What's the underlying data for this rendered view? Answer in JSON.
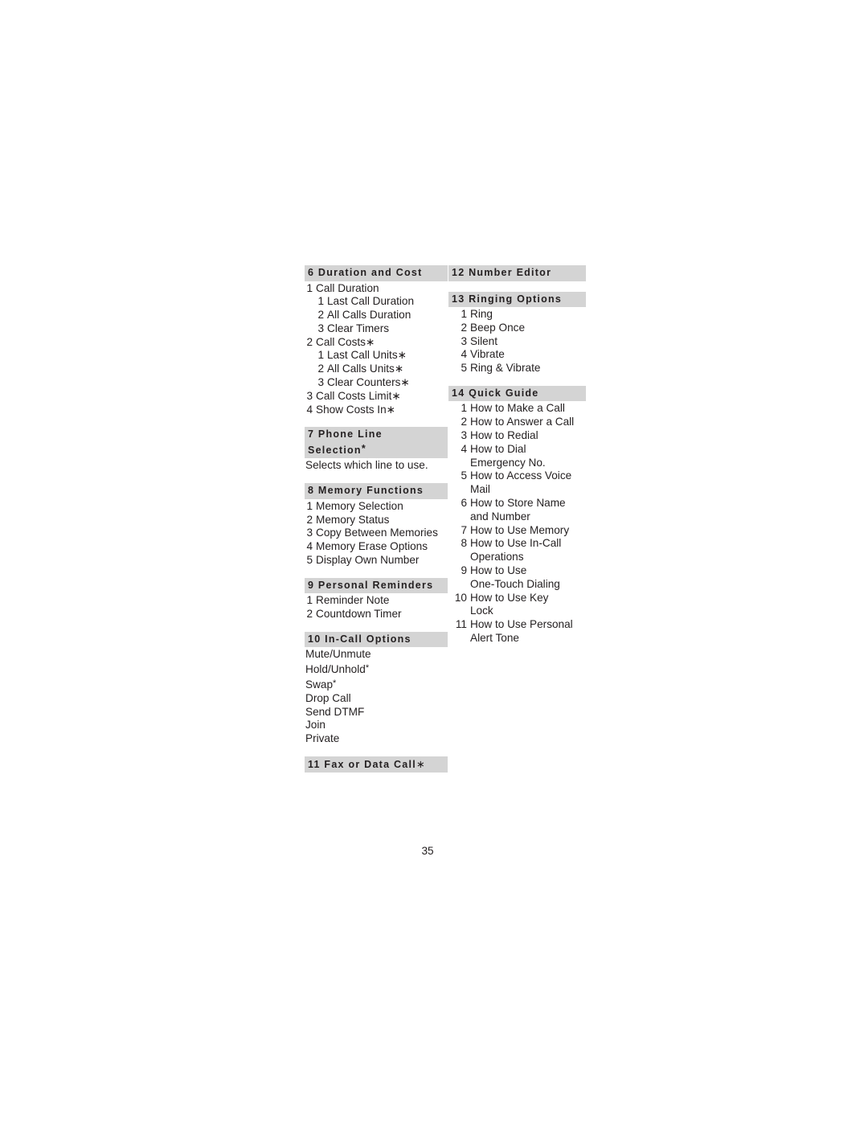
{
  "page": {
    "number": "35"
  },
  "columns": {
    "left": [
      {
        "id": "duration-and-cost",
        "heading": "6 Duration and Cost",
        "heading_suffix": "",
        "items": [
          {
            "num": "1",
            "label": "Call Duration",
            "level": 1,
            "suffix": ""
          },
          {
            "num": "1",
            "label": "Last Call Duration",
            "level": 2,
            "suffix": ""
          },
          {
            "num": "2",
            "label": "All Calls Duration",
            "level": 2,
            "suffix": ""
          },
          {
            "num": "3",
            "label": "Clear Timers",
            "level": 2,
            "suffix": ""
          },
          {
            "num": "2",
            "label": "Call Costs",
            "level": 1,
            "suffix": "∗"
          },
          {
            "num": "1",
            "label": "Last Call Units",
            "level": 2,
            "suffix": "∗"
          },
          {
            "num": "2",
            "label": "All Calls Units",
            "level": 2,
            "suffix": "∗"
          },
          {
            "num": "3",
            "label": "Clear Counters",
            "level": 2,
            "suffix": "∗"
          },
          {
            "num": "3",
            "label": "Call Costs Limit",
            "level": 1,
            "suffix": "∗"
          },
          {
            "num": "4",
            "label": "Show Costs In",
            "level": 1,
            "suffix": "∗"
          }
        ],
        "text": ""
      },
      {
        "id": "phone-line-selection",
        "heading": "7 Phone Line\nSelection",
        "heading_suffix": "*",
        "items": [],
        "text": "Selects which line to use."
      },
      {
        "id": "memory-functions",
        "heading": "8 Memory Functions",
        "heading_suffix": "",
        "items": [
          {
            "num": "1",
            "label": "Memory Selection",
            "level": 1,
            "suffix": ""
          },
          {
            "num": "2",
            "label": "Memory Status",
            "level": 1,
            "suffix": ""
          },
          {
            "num": "3",
            "label": "Copy Between Memories",
            "level": 1,
            "suffix": ""
          },
          {
            "num": "4",
            "label": "Memory Erase Options",
            "level": 1,
            "suffix": ""
          },
          {
            "num": "5",
            "label": "Display Own Number",
            "level": 1,
            "suffix": ""
          }
        ],
        "text": ""
      },
      {
        "id": "personal-reminders",
        "heading": "9 Personal Reminders",
        "heading_suffix": "",
        "items": [
          {
            "num": "1",
            "label": "Reminder Note",
            "level": 1,
            "suffix": ""
          },
          {
            "num": "2",
            "label": "Countdown Timer",
            "level": 1,
            "suffix": ""
          }
        ],
        "text": ""
      },
      {
        "id": "in-call-options",
        "heading": "10 In-Call Options",
        "heading_suffix": "",
        "items": [
          {
            "num": "",
            "label": "Mute/Unmute",
            "level": 0,
            "suffix": ""
          },
          {
            "num": "",
            "label": "Hold/Unhold",
            "level": 0,
            "suffix": "*"
          },
          {
            "num": "",
            "label": "Swap",
            "level": 0,
            "suffix": "*"
          },
          {
            "num": "",
            "label": "Drop Call",
            "level": 0,
            "suffix": ""
          },
          {
            "num": "",
            "label": "Send DTMF",
            "level": 0,
            "suffix": ""
          },
          {
            "num": "",
            "label": "Join",
            "level": 0,
            "suffix": ""
          },
          {
            "num": "",
            "label": "Private",
            "level": 0,
            "suffix": ""
          }
        ],
        "text": ""
      },
      {
        "id": "fax-or-data-call",
        "heading": "11 Fax or Data Call",
        "heading_suffix": "∗",
        "items": [],
        "text": ""
      }
    ],
    "right": [
      {
        "id": "number-editor",
        "heading": "12 Number Editor",
        "heading_suffix": "",
        "items": [],
        "text": ""
      },
      {
        "id": "ringing-options",
        "heading": "13 Ringing Options",
        "heading_suffix": "",
        "items": [
          {
            "num": "1",
            "label": "Ring",
            "level": 1,
            "suffix": ""
          },
          {
            "num": "2",
            "label": "Beep Once",
            "level": 1,
            "suffix": ""
          },
          {
            "num": "3",
            "label": "Silent",
            "level": 1,
            "suffix": ""
          },
          {
            "num": "4",
            "label": "Vibrate",
            "level": 1,
            "suffix": ""
          },
          {
            "num": "5",
            "label": "Ring & Vibrate",
            "level": 1,
            "suffix": ""
          }
        ],
        "text": ""
      },
      {
        "id": "quick-guide",
        "heading": "14 Quick Guide",
        "heading_suffix": "",
        "items": [
          {
            "num": "1",
            "label": "How to Make a Call",
            "level": 1,
            "suffix": ""
          },
          {
            "num": "2",
            "label": "How to Answer a Call",
            "level": 1,
            "suffix": ""
          },
          {
            "num": "3",
            "label": "How to Redial",
            "level": 1,
            "suffix": ""
          },
          {
            "num": "4",
            "label": "How to Dial\nEmergency No.",
            "level": 1,
            "suffix": ""
          },
          {
            "num": "5",
            "label": "How to Access Voice\nMail",
            "level": 1,
            "suffix": ""
          },
          {
            "num": "6",
            "label": "How to Store Name\nand Number",
            "level": 1,
            "suffix": ""
          },
          {
            "num": "7",
            "label": "How to Use Memory",
            "level": 1,
            "suffix": ""
          },
          {
            "num": "8",
            "label": "How to Use In-Call\nOperations",
            "level": 1,
            "suffix": ""
          },
          {
            "num": "9",
            "label": "How to Use\nOne-Touch Dialing",
            "level": 1,
            "suffix": ""
          },
          {
            "num": "10",
            "label": "How to Use Key\nLock",
            "level": 1,
            "suffix": ""
          },
          {
            "num": "11",
            "label": "How to Use Personal\nAlert Tone",
            "level": 1,
            "suffix": ""
          }
        ],
        "text": ""
      }
    ]
  }
}
